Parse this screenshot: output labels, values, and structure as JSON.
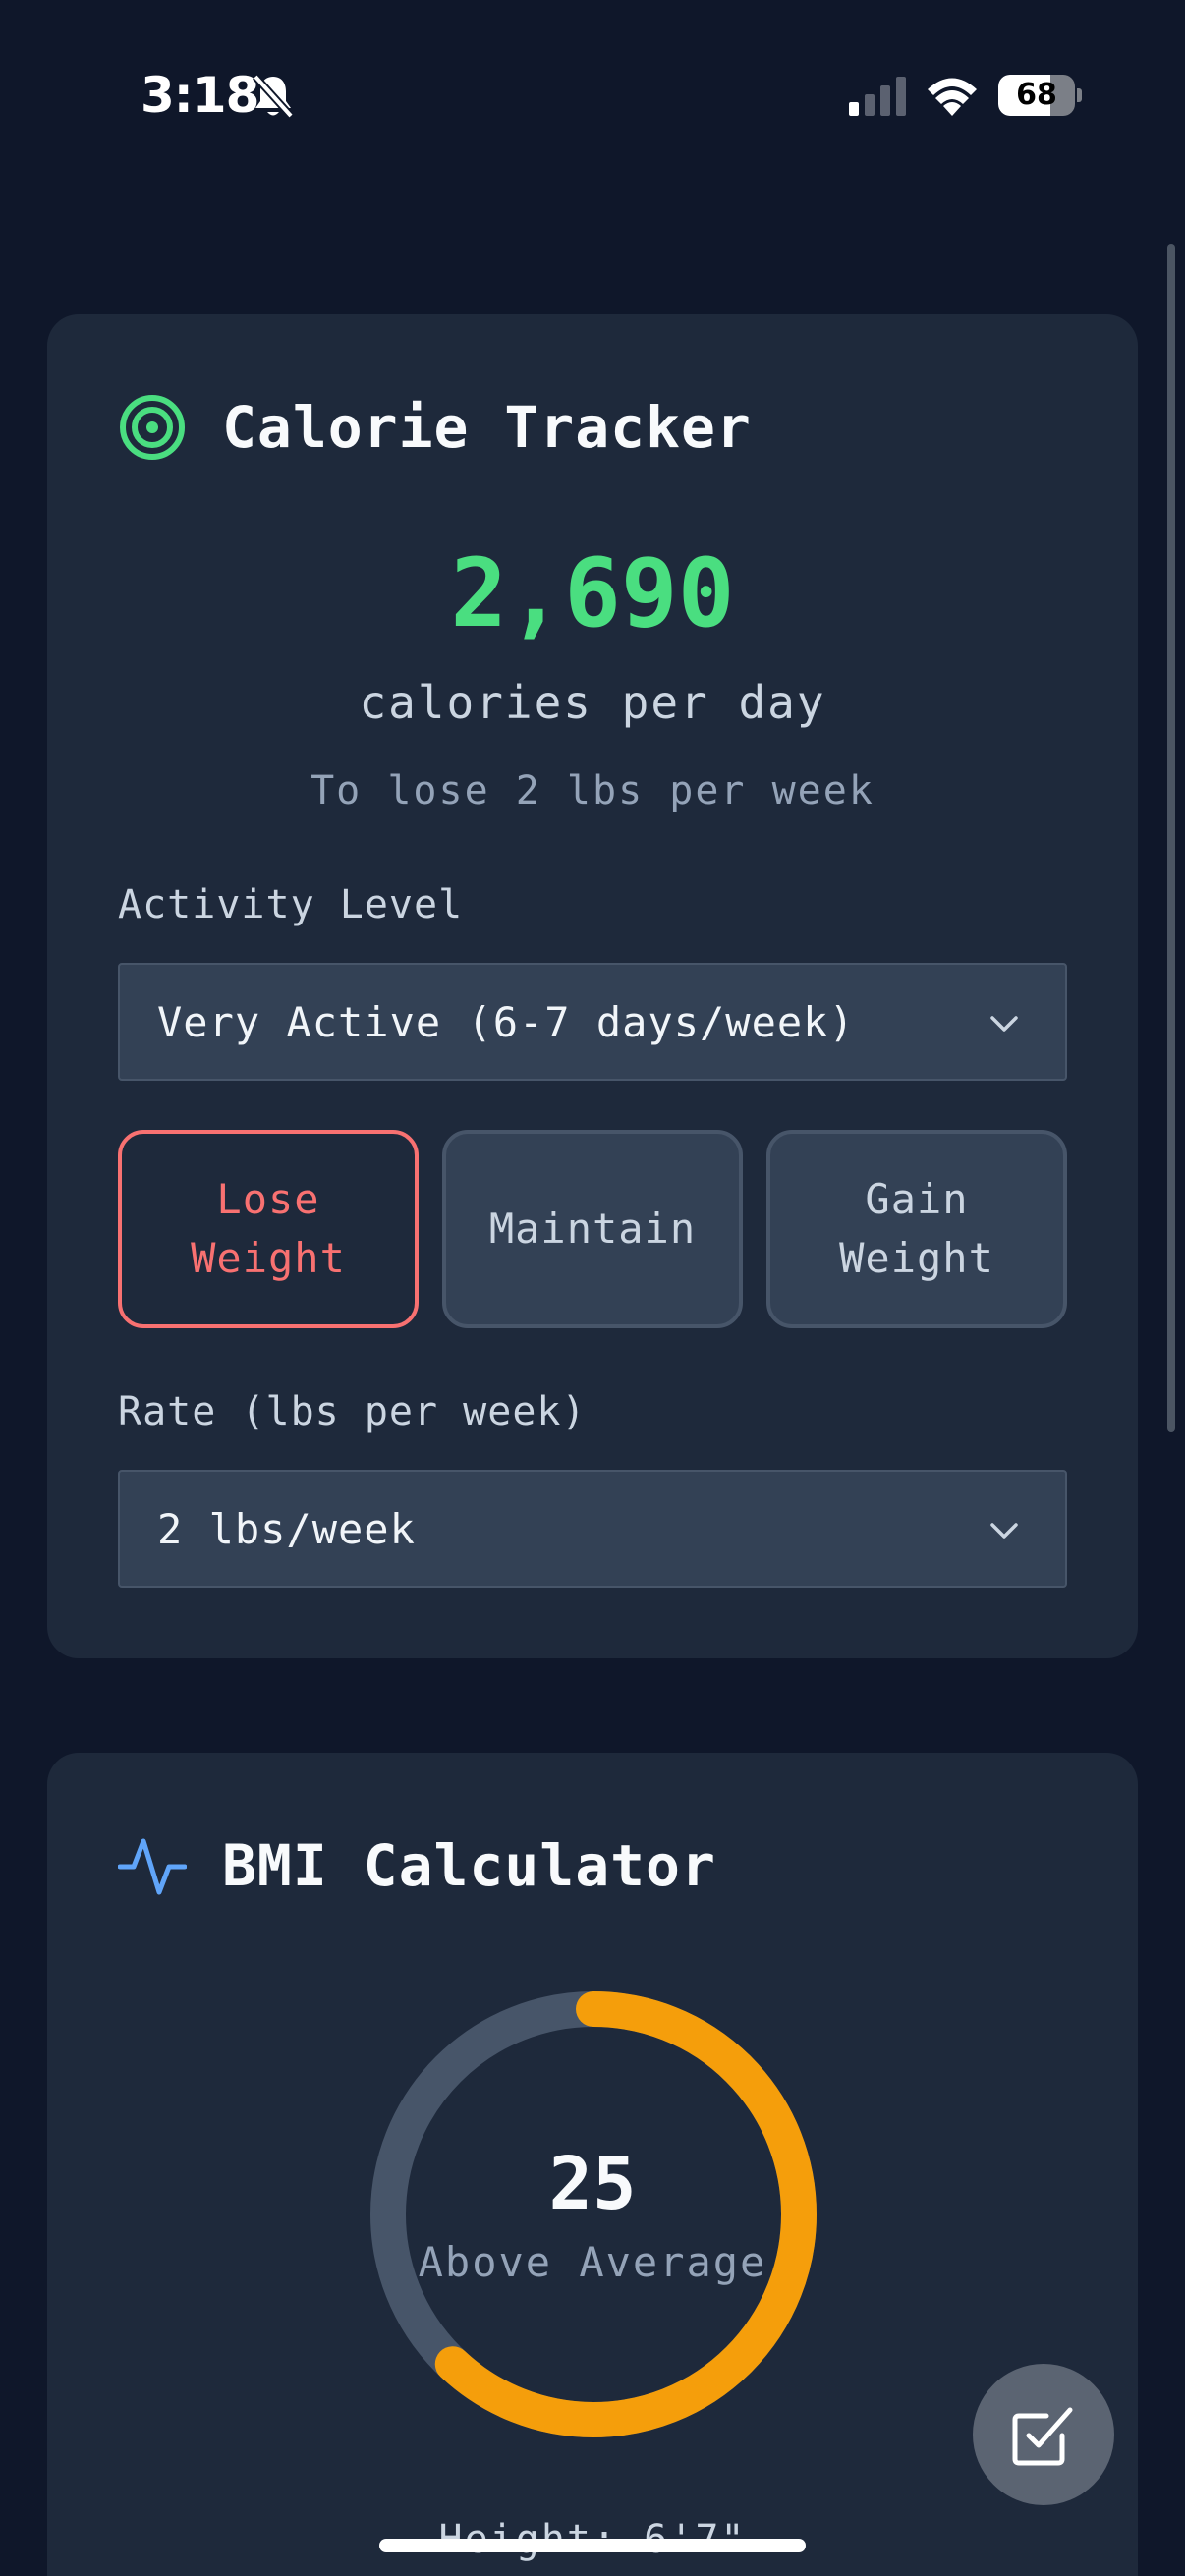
{
  "status_bar": {
    "time": "3:18",
    "battery": "68",
    "battery_level": 0.68
  },
  "calorie_tracker": {
    "title": "Calorie Tracker",
    "calories": "2,690",
    "unit": "calories per day",
    "goal_text": "To lose 2 lbs per week",
    "activity_label": "Activity Level",
    "activity_value": "Very Active (6-7 days/week)",
    "goals": [
      {
        "label_line1": "Lose",
        "label_line2": "Weight",
        "selected": true
      },
      {
        "label_line1": "Maintain",
        "label_line2": "",
        "selected": false
      },
      {
        "label_line1": "Gain",
        "label_line2": "Weight",
        "selected": false
      }
    ],
    "rate_label": "Rate (lbs per week)",
    "rate_value": "2 lbs/week"
  },
  "bmi_calculator": {
    "title": "BMI Calculator",
    "value": "25",
    "status": "Above Average",
    "gauge_fraction": 0.62,
    "height_text": "Height: 6'7\""
  },
  "colors": {
    "background": "#0f172a",
    "card": "#1e293b",
    "accent_green": "#4ade80",
    "accent_red": "#f87171",
    "accent_orange": "#f59e0b",
    "accent_blue": "#60a5fa"
  },
  "icons": {
    "calorie": "target-icon",
    "bmi": "activity-pulse-icon",
    "fab": "checkbox-edit-icon"
  }
}
